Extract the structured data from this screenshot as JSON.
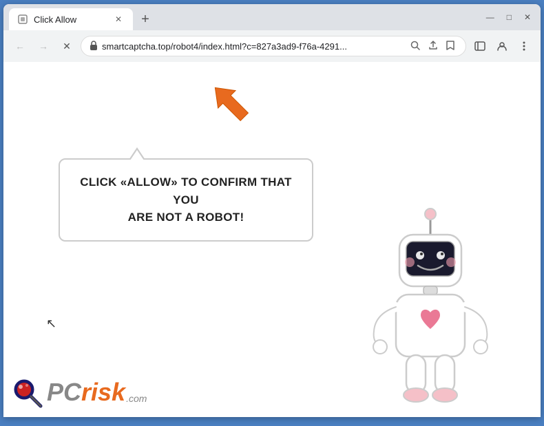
{
  "browser": {
    "tab": {
      "title": "Click Allow",
      "favicon": "🔒"
    },
    "new_tab_label": "+",
    "window_controls": {
      "minimize": "—",
      "maximize": "□",
      "close": "✕"
    },
    "nav": {
      "back": "←",
      "forward": "→",
      "reload": "✕",
      "url": "smartcaptcha.top/robot4/index.html?c=827a3ad9-f76a-4291...",
      "search_icon": "🔍",
      "share_icon": "↑",
      "bookmark_icon": "☆",
      "sidebar_icon": "▭",
      "profile_icon": "👤",
      "menu_icon": "⋮"
    }
  },
  "page": {
    "bubble_text_line1": "CLICK «ALLOW» TO CONFIRM THAT YOU",
    "bubble_text_line2": "ARE NOT A ROBOT!",
    "pcrisk_pc": "PC",
    "pcrisk_risk": "risk",
    "pcrisk_com": ".com"
  }
}
